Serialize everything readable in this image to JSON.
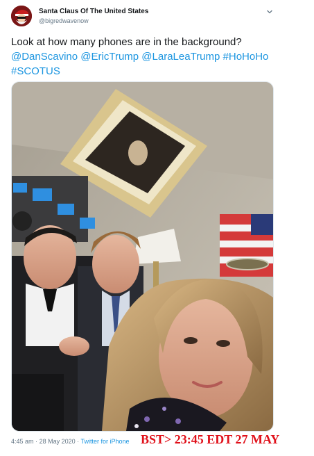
{
  "user": {
    "display_name": "Santa Claus Of The United States",
    "handle": "@bigredwavenow",
    "avatar_icon": "santa-avatar-icon"
  },
  "tweet": {
    "text_line1": "Look at how many phones are in the background?",
    "mentions": [
      "@DanScavino",
      "@EricTrump",
      "@LaraLeaTrump"
    ],
    "hashtags": [
      "#HoHoHo",
      "#SCOTUS"
    ]
  },
  "meta": {
    "time": "4:45 am",
    "separator": "·",
    "date": "28 May 2020",
    "source": "Twitter for iPhone"
  },
  "annotation": {
    "text": "BST> 23:45 EDT 27 MAY",
    "color": "#e0101a"
  },
  "colors": {
    "link": "#1b95e0",
    "secondary_text": "#657786",
    "primary_text": "#14171a"
  },
  "icons": {
    "more": "chevron-down-icon"
  }
}
